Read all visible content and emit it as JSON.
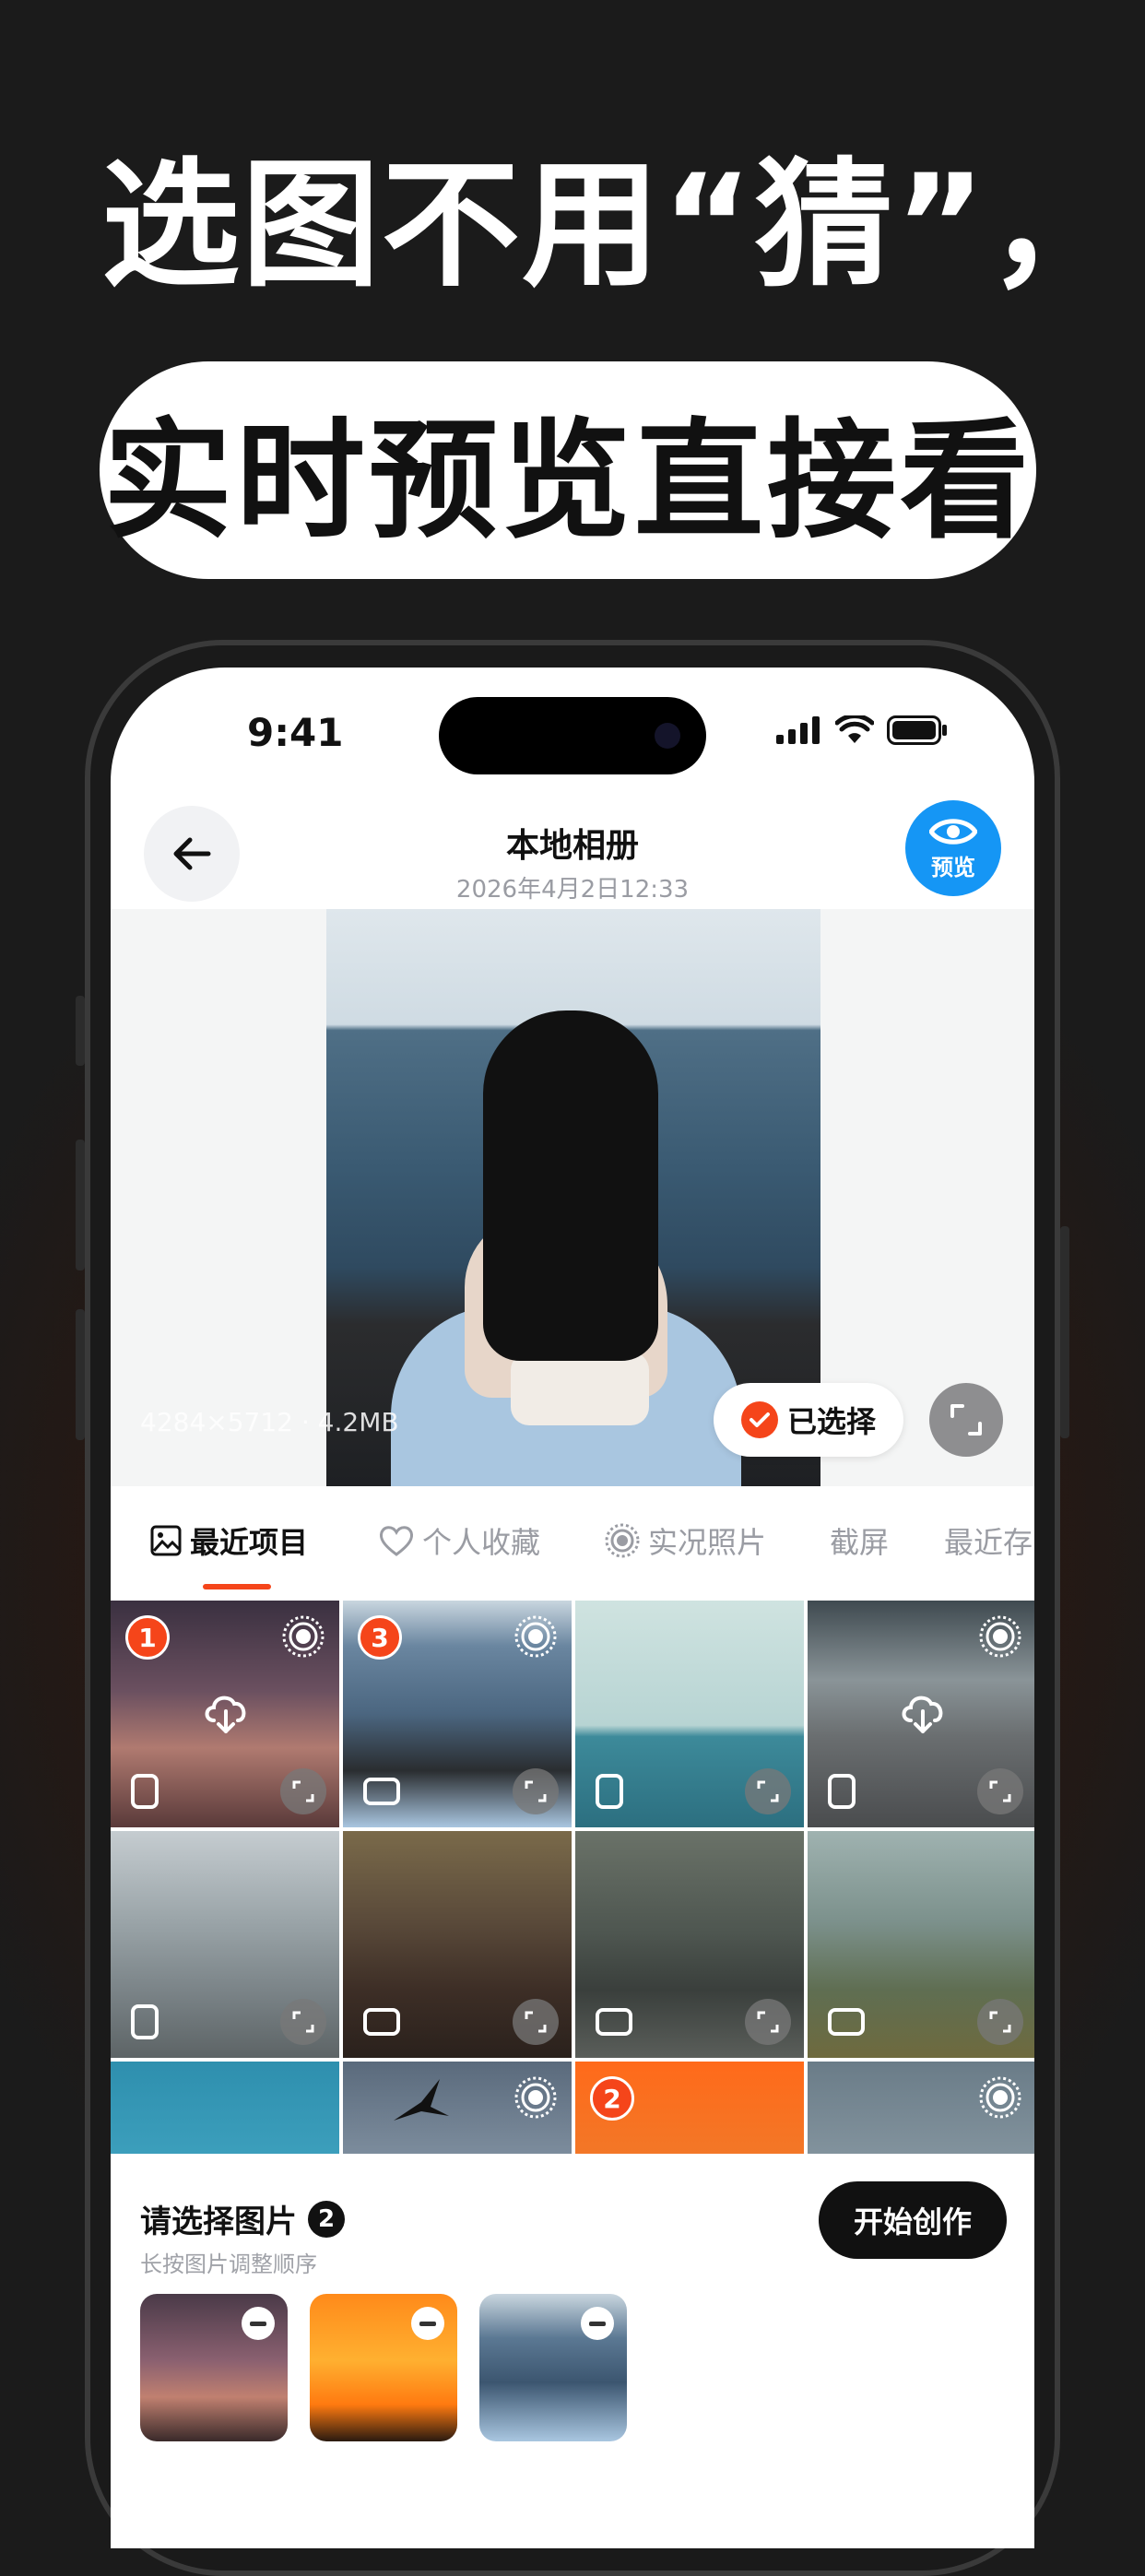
{
  "headline": {
    "line1": "选图不用“猜”，",
    "line2": "实时预览直接看"
  },
  "status": {
    "time": "9:41"
  },
  "nav": {
    "title": "本地相册",
    "subtitle": "2026年4月2日12:33",
    "preview_label": "预览"
  },
  "preview": {
    "info": "4284×5712 · 4.2MB",
    "selected_label": "已选择"
  },
  "tabs": [
    {
      "label": "最近项目",
      "icon": "image-icon",
      "active": true
    },
    {
      "label": "个人收藏",
      "icon": "heart-icon",
      "active": false
    },
    {
      "label": "实况照片",
      "icon": "live-photo-icon",
      "active": false
    },
    {
      "label": "截屏",
      "icon": "",
      "active": false
    },
    {
      "label": "最近存",
      "icon": "",
      "active": false
    }
  ],
  "grid": {
    "badges": {
      "c0": "1",
      "c1": "3",
      "c10": "2"
    }
  },
  "bottom": {
    "title": "请选择图片",
    "count": "2",
    "hint": "长按图片调整顺序",
    "create_label": "开始创作"
  },
  "colors": {
    "accent": "#f5451a",
    "preview_blue": "#1596f5",
    "dark": "#111111"
  }
}
